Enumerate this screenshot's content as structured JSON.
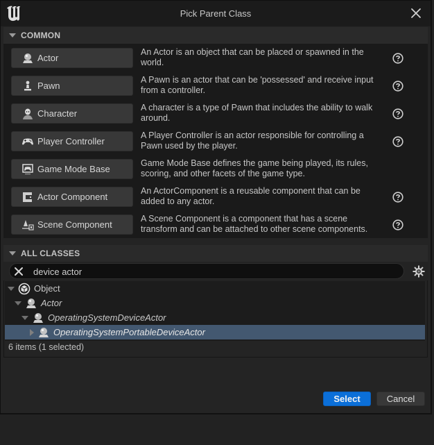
{
  "window": {
    "title": "Pick Parent Class",
    "logo_icon": "unreal-engine-logo-icon",
    "close_icon": "close-icon"
  },
  "common": {
    "header": "COMMON",
    "items": [
      {
        "label": "Actor",
        "icon": "actor-sphere-icon",
        "description_line1": "An Actor is an object that can be placed or spawned in the",
        "description_line2": "world.",
        "has_help": true
      },
      {
        "label": "Pawn",
        "icon": "pawn-icon",
        "description_line1": "A Pawn is an actor that can be 'possessed' and receive input",
        "description_line2": "from a controller.",
        "has_help": true
      },
      {
        "label": "Character",
        "icon": "character-icon",
        "description_line1": "A character is a type of Pawn that includes the ability to walk",
        "description_line2": "around.",
        "has_help": true
      },
      {
        "label": "Player Controller",
        "icon": "gamepad-icon",
        "description_line1": "A Player Controller is an actor responsible for controlling a",
        "description_line2": "Pawn used by the player.",
        "has_help": true
      },
      {
        "label": "Game Mode Base",
        "icon": "game-mode-icon",
        "description_line1": "Game Mode Base defines the game being played, its rules,",
        "description_line2": "scoring, and other facets of the game type.",
        "has_help": false
      },
      {
        "label": "Actor Component",
        "icon": "actor-component-icon",
        "description_line1": "An ActorComponent is a reusable component that can be",
        "description_line2": "added to any actor.",
        "has_help": true
      },
      {
        "label": "Scene Component",
        "icon": "scene-component-icon",
        "description_line1": "A Scene Component is a component that has a scene",
        "description_line2": "transform and can be attached to other scene components.",
        "has_help": true
      }
    ]
  },
  "all_classes": {
    "header": "ALL CLASSES",
    "search": {
      "value": "device actor",
      "placeholder": "Search"
    },
    "tree": [
      {
        "label": "Object",
        "depth": 0,
        "expanded": true,
        "italic": false,
        "selected": false,
        "icon": "object-icon"
      },
      {
        "label": "Actor",
        "depth": 1,
        "expanded": true,
        "italic": true,
        "selected": false,
        "icon": "actor-sphere-icon"
      },
      {
        "label": "OperatingSystemDeviceActor",
        "depth": 2,
        "expanded": true,
        "italic": true,
        "selected": false,
        "icon": "actor-sphere-icon"
      },
      {
        "label": "OperatingSystemPortableDeviceActor",
        "depth": 3,
        "expanded": false,
        "italic": true,
        "selected": true,
        "icon": "actor-sphere-icon"
      }
    ],
    "status": "6 items (1 selected)"
  },
  "buttons": {
    "select": "Select",
    "cancel": "Cancel"
  },
  "colors": {
    "accent": "#0b6fd8",
    "selection": "#435870"
  }
}
